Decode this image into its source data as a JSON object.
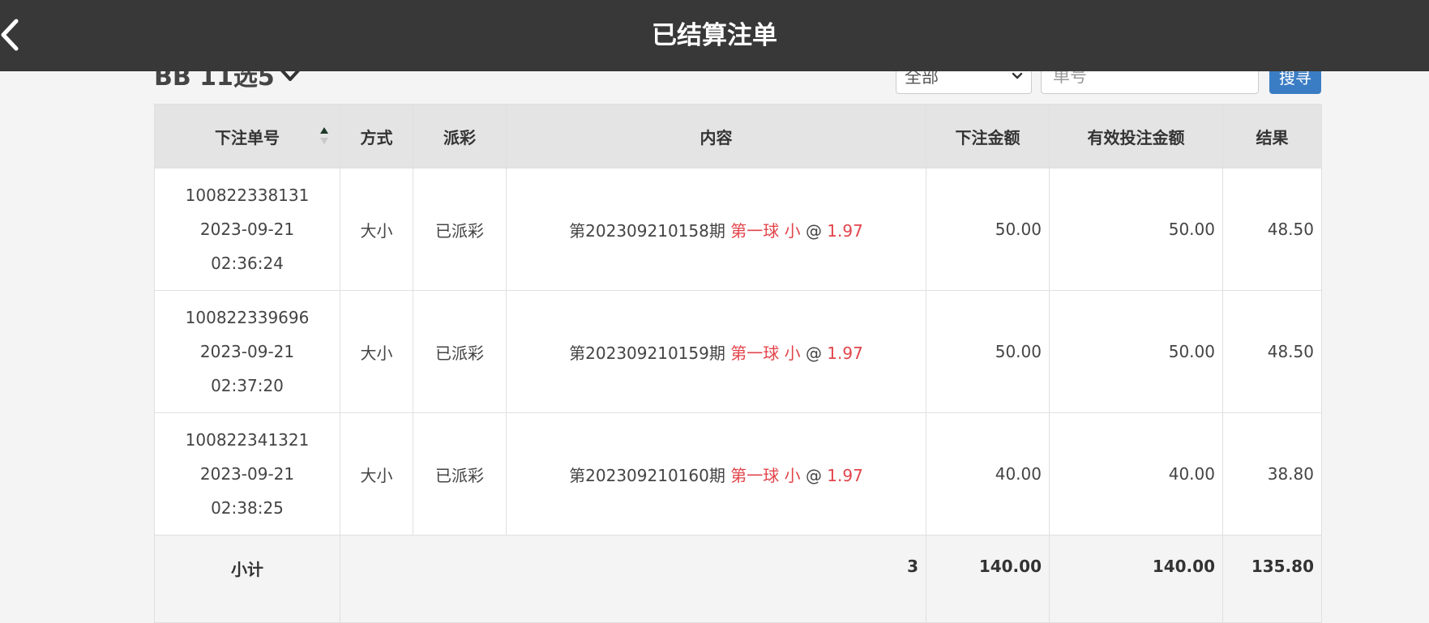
{
  "header": {
    "title": "已结算注单"
  },
  "toolbar": {
    "game_name": "BB 11选5",
    "filter_value": "全部",
    "search_placeholder": "单号",
    "search_label": "搜寻"
  },
  "table": {
    "columns": [
      "下注单号",
      "方式",
      "派彩",
      "内容",
      "下注金额",
      "有效投注金额",
      "结果"
    ],
    "rows": [
      {
        "order_no": "100822338131",
        "date": "2023-09-21",
        "time": "02:36:24",
        "method": "大小",
        "payout": "已派彩",
        "period": "第202309210158期",
        "selection": "第一球 小",
        "at": "@",
        "odds": "1.97",
        "bet_amount": "50.00",
        "valid_amount": "50.00",
        "result": "48.50"
      },
      {
        "order_no": "100822339696",
        "date": "2023-09-21",
        "time": "02:37:20",
        "method": "大小",
        "payout": "已派彩",
        "period": "第202309210159期",
        "selection": "第一球 小",
        "at": "@",
        "odds": "1.97",
        "bet_amount": "50.00",
        "valid_amount": "50.00",
        "result": "48.50"
      },
      {
        "order_no": "100822341321",
        "date": "2023-09-21",
        "time": "02:38:25",
        "method": "大小",
        "payout": "已派彩",
        "period": "第202309210160期",
        "selection": "第一球 小",
        "at": "@",
        "odds": "1.97",
        "bet_amount": "40.00",
        "valid_amount": "40.00",
        "result": "38.80"
      }
    ],
    "subtotal": {
      "label": "小计",
      "count": "3",
      "bet_amount": "140.00",
      "valid_amount": "140.00",
      "result": "135.80"
    }
  },
  "colors": {
    "header_bg": "#383838",
    "highlight": "#e2454b",
    "button": "#3b7dc4"
  },
  "icons": {
    "back": "chevron-left-icon",
    "dropdown": "chevron-down-icon",
    "sort": "sort-icon"
  }
}
